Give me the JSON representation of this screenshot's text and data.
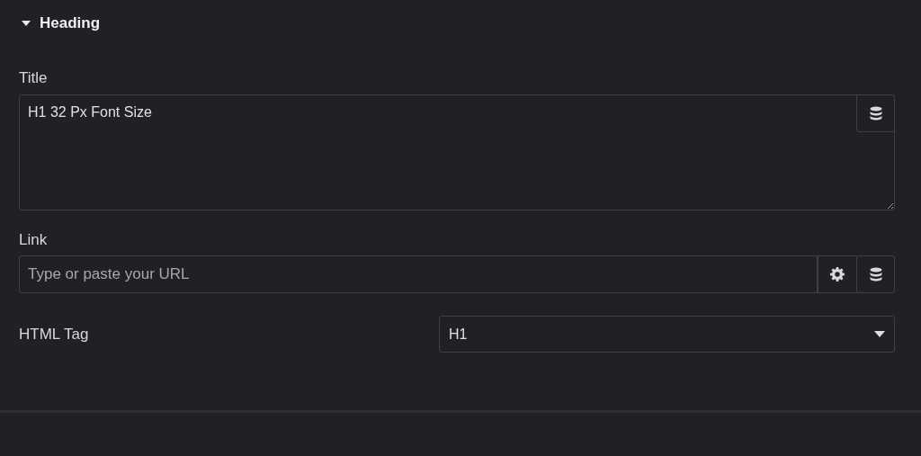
{
  "section": {
    "title": "Heading",
    "expanded": true
  },
  "title_field": {
    "label": "Title",
    "value": "H1 32 Px Font Size"
  },
  "link_field": {
    "label": "Link",
    "placeholder": "Type or paste your URL"
  },
  "html_tag": {
    "label": "HTML Tag",
    "value": "H1"
  }
}
